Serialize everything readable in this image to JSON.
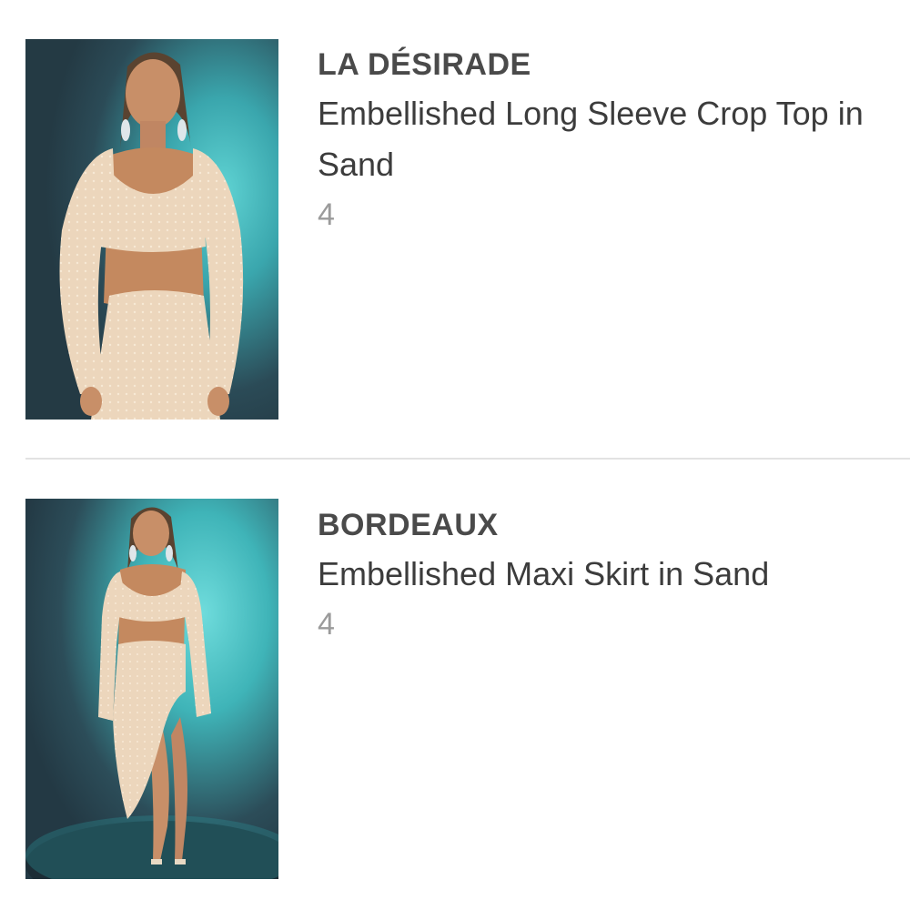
{
  "items": [
    {
      "brand": "LA DÉSIRADE",
      "name": "Embellished Long Sleeve Crop Top in Sand",
      "quantity": "4",
      "image": "model in sand embellished crop top and skirt"
    },
    {
      "brand": "BORDEAUX",
      "name": "Embellished Maxi Skirt in Sand",
      "quantity": "4",
      "image": "model in sand embellished maxi skirt with high slit"
    }
  ],
  "colors": {
    "backdrop_dark": "#2e4a55",
    "backdrop_teal": "#3fb4b8",
    "garment_sand": "#ecd6bc",
    "skin": "#c88f68",
    "divider": "#e2e2e2"
  }
}
